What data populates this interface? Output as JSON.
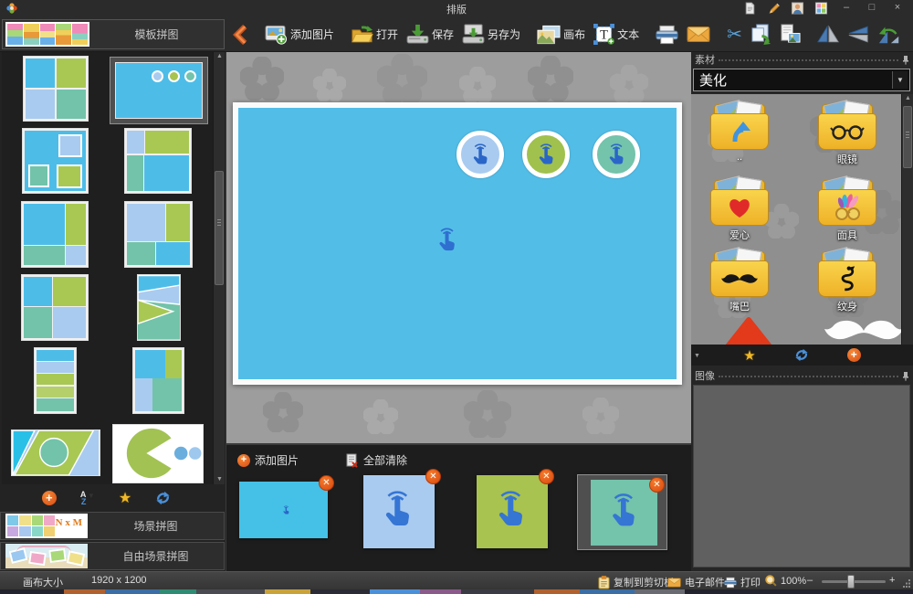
{
  "titlebar": {
    "title": "排版",
    "minimize_glyph": "–",
    "maximize_glyph": "□",
    "close_glyph": "×",
    "mode_icons": [
      "new-document-icon",
      "edit-pencil-icon",
      "portrait-editor-icon",
      "collage-grid-icon"
    ]
  },
  "toolbar": {
    "add_image_label": "添加图片",
    "open_label": "打开",
    "save_label": "保存",
    "save_as_label": "另存为",
    "canvas_label": "画布",
    "text_label": "文本",
    "icons": [
      "back-icon",
      "add-image-icon",
      "open-icon",
      "save-icon",
      "save-as-icon",
      "canvas-icon",
      "text-icon",
      "print-icon",
      "mail-icon",
      "cut-icon",
      "copy-icon",
      "paste-icon",
      "flip-horizontal-icon",
      "flip-vertical-icon",
      "rotate-left-icon",
      "rotate-right-icon",
      "free-rotate-icon",
      "zoom-in-icon",
      "zoom-out-icon"
    ]
  },
  "left_panel": {
    "header_label": "模板拼图",
    "scene_label": "场景拼图",
    "scene_thumb_text": "N x M",
    "free_scene_label": "自由场景拼图"
  },
  "right_panel": {
    "material_header": "素材",
    "category": "美化",
    "folders": [
      {
        "label": "..",
        "icon": "up-arrow-icon"
      },
      {
        "label": "眼镜",
        "icon": "glasses-icon"
      },
      {
        "label": "爱心",
        "icon": "heart-icon"
      },
      {
        "label": "面具",
        "icon": "mask-icon"
      },
      {
        "label": "嘴巴",
        "icon": "mustache-icon"
      },
      {
        "label": "纹身",
        "icon": "dragon-icon"
      }
    ],
    "image_header": "图像"
  },
  "filmstrip": {
    "add_image_label": "添加图片",
    "clear_all_label": "全部清除",
    "photo_count": 4
  },
  "statusbar": {
    "canvas_size_label": "画布大小",
    "canvas_size_value": "1920 x 1200",
    "copy_clipboard_label": "复制到剪切板",
    "email_label": "电子邮件",
    "print_label": "打印",
    "zoom_value": "100%",
    "zoom_out_glyph": "–",
    "zoom_in_glyph": "+"
  },
  "colors": {
    "canvas_blue": "#52BEE8",
    "accent_orange": "#E8571A",
    "palette_green": "#A8C34F",
    "palette_light_blue": "#A9CBEF",
    "palette_teal": "#74C3AB",
    "hand_blue": "#2F6FD0",
    "folder_yellow": "#F0C23B"
  }
}
